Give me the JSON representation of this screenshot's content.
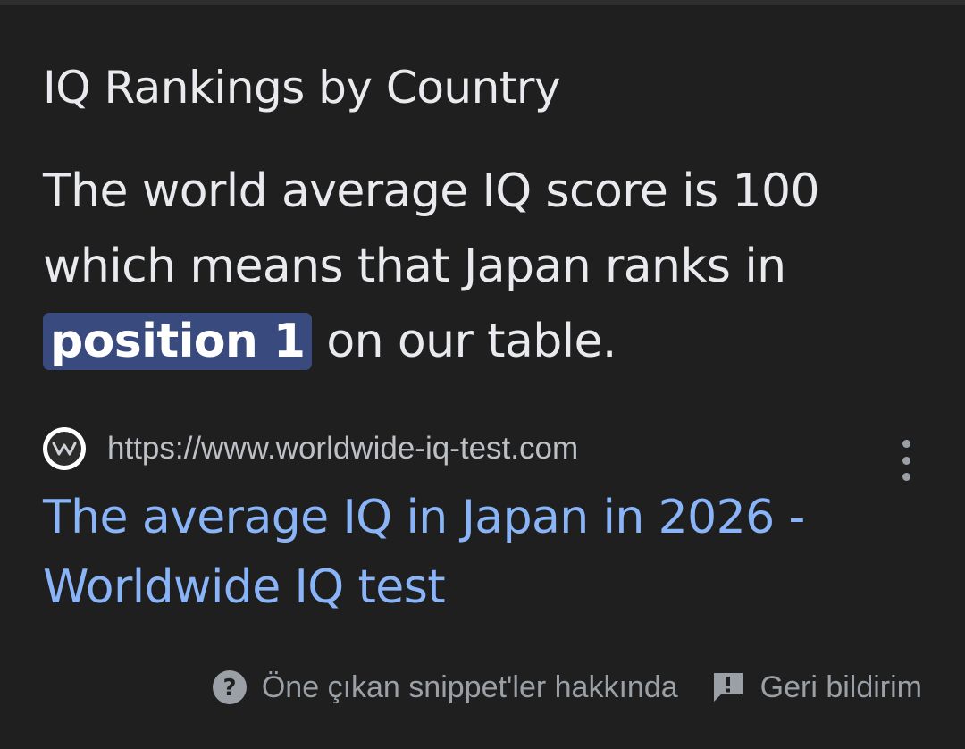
{
  "heading": "IQ Rankings by Country",
  "snippet": {
    "before": "The world average IQ score is 100 which means that Japan ranks in",
    "highlight": "position 1",
    "after": "on our table."
  },
  "source": {
    "favicon_icon": "worldwide-iq-test-favicon",
    "url": "https://www.worldwide-iq-test.com",
    "menu_icon": "more-vert-icon"
  },
  "result": {
    "title": "The average IQ in Japan in 2026 - Worldwide IQ test"
  },
  "footer": {
    "about_icon": "help-circle-icon",
    "about_label": "Öne çıkan snippet'ler hakkında",
    "feedback_icon": "feedback-icon",
    "feedback_label": "Geri bildirim"
  },
  "colors": {
    "background": "#1f1f1f",
    "text": "#e8eaed",
    "link": "#8ab4f8",
    "highlight": "#394a7e",
    "muted": "#9aa0a6"
  }
}
